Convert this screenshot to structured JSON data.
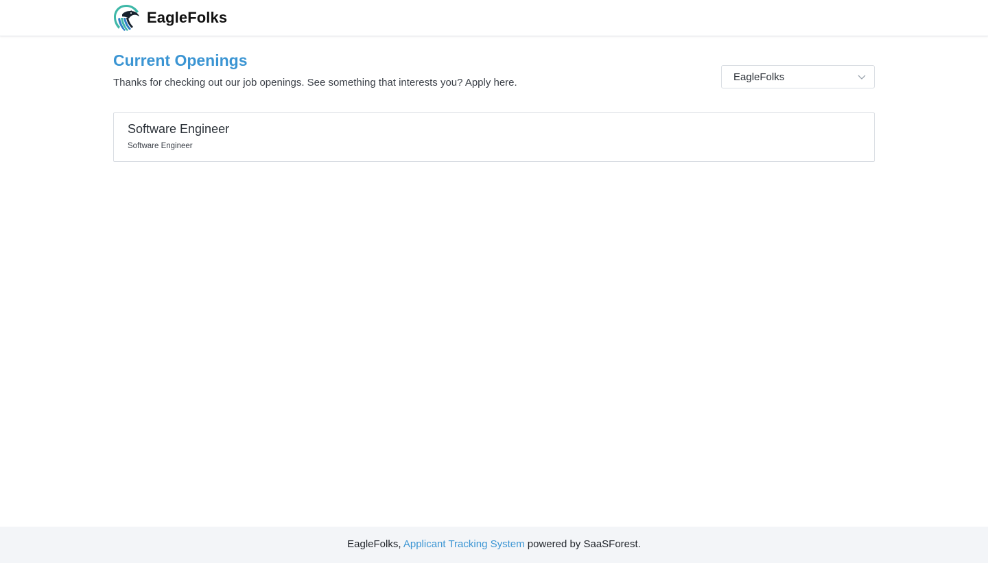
{
  "header": {
    "brand_name": "EagleFolks",
    "logo_icon": "eagle-head-icon",
    "colors": {
      "logo_teal": "#3fb8a8",
      "logo_blue": "#2f7fc6",
      "logo_dark": "#16202c"
    }
  },
  "main": {
    "title": "Current Openings",
    "subtitle": "Thanks for checking out our job openings. See something that interests you? Apply here.",
    "company_select": {
      "value": "EagleFolks",
      "icon": "chevron-down-icon"
    },
    "jobs": [
      {
        "title": "Software Engineer",
        "department": "Software Engineer"
      }
    ]
  },
  "footer": {
    "prefix": "EagleFolks, ",
    "link_text": "Applicant Tracking System",
    "suffix": " powered by SaaSForest."
  },
  "colors": {
    "accent": "#3b95d3",
    "footer_bg": "#f3f5f8",
    "border": "#d9dde3"
  }
}
